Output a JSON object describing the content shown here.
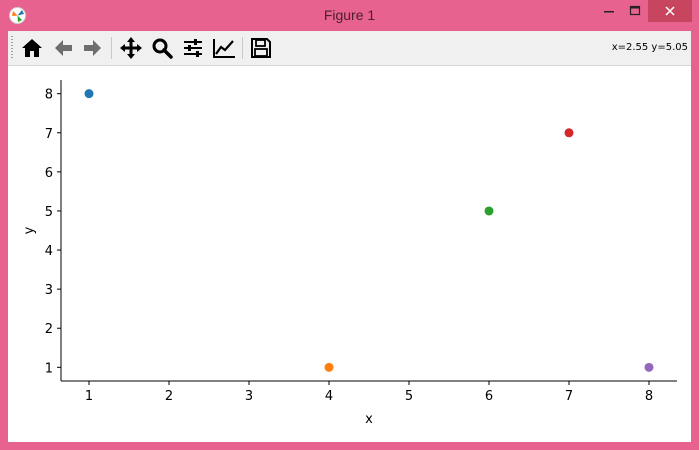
{
  "window": {
    "title": "Figure 1"
  },
  "toolbar": {
    "buttons": [
      {
        "name": "home-icon"
      },
      {
        "name": "back-arrow-icon"
      },
      {
        "name": "forward-arrow-icon"
      },
      {
        "name": "pan-move-icon"
      },
      {
        "name": "zoom-magnifier-icon"
      },
      {
        "name": "configure-subplots-icon"
      },
      {
        "name": "edit-axes-icon"
      },
      {
        "name": "save-floppy-icon"
      }
    ],
    "coords": "x=2.55 y=5.05"
  },
  "chart_data": {
    "type": "scatter",
    "xlabel": "x",
    "ylabel": "y",
    "xlim": [
      0.65,
      8.35
    ],
    "ylim": [
      0.65,
      8.35
    ],
    "xticks": [
      1,
      2,
      3,
      4,
      5,
      6,
      7,
      8
    ],
    "yticks": [
      1,
      2,
      3,
      4,
      5,
      6,
      7,
      8
    ],
    "x_tick_labels": [
      "1",
      "2",
      "3",
      "4",
      "5",
      "6",
      "7",
      "8"
    ],
    "y_tick_labels": [
      "1",
      "2",
      "3",
      "4",
      "5",
      "6",
      "7",
      "8"
    ],
    "points": [
      {
        "x": 1,
        "y": 8,
        "color": "#1f77b4"
      },
      {
        "x": 4,
        "y": 1,
        "color": "#ff7f0e"
      },
      {
        "x": 6,
        "y": 5,
        "color": "#2ca02c"
      },
      {
        "x": 7,
        "y": 7,
        "color": "#d62728"
      },
      {
        "x": 8,
        "y": 1,
        "color": "#9467bd"
      }
    ]
  }
}
